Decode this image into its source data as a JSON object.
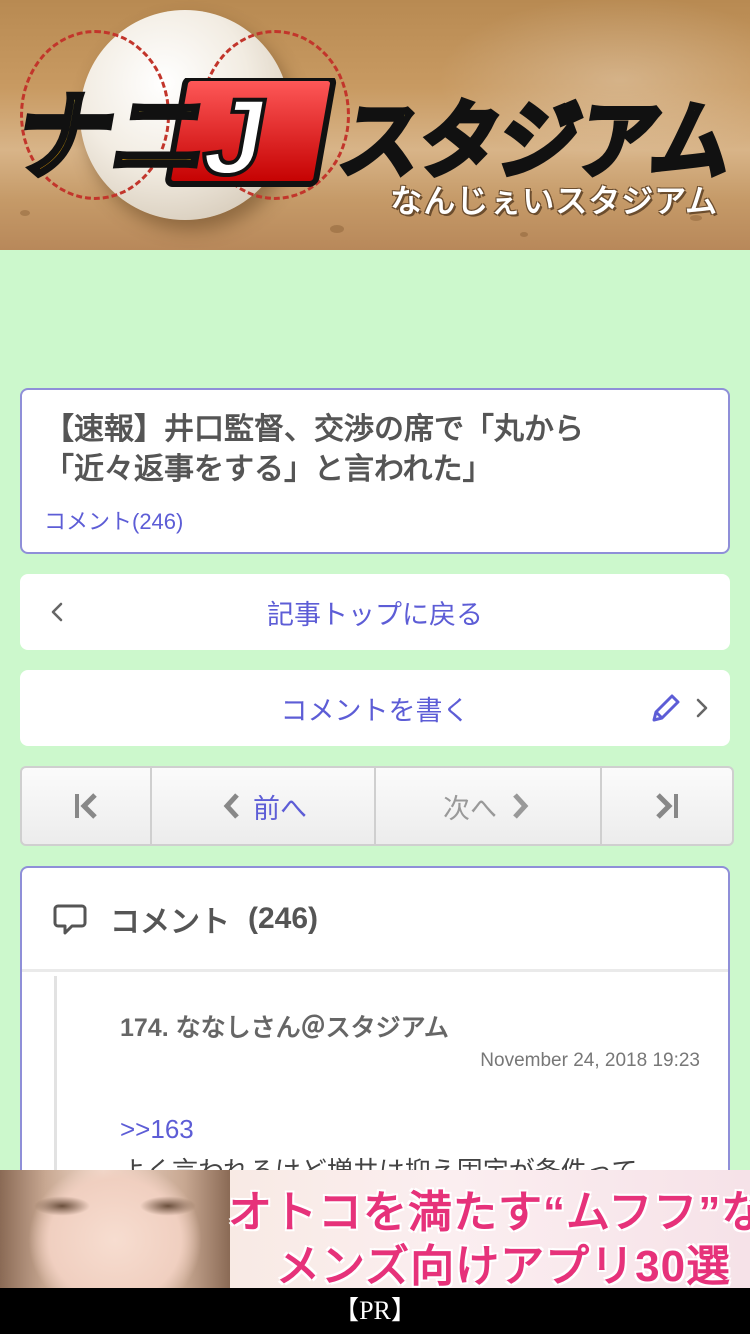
{
  "header": {
    "logo_text": "ナニJスタジアム",
    "logo_sub": "なんじぇいスタジアム"
  },
  "article": {
    "title": "【速報】井口監督、交渉の席で「丸から「近々返事をする」と言われた」",
    "comment_link": "コメント(246)"
  },
  "buttons": {
    "back_label": "記事トップに戻る",
    "write_label": "コメントを書く"
  },
  "pager": {
    "prev_label": "前へ",
    "next_label": "次へ"
  },
  "comments": {
    "header_label": "コメント",
    "count": "(246)",
    "items": [
      {
        "head": "174.  ななしさん＠スタジアム",
        "date": "November 24, 2018 19:23",
        "reply": ">>163",
        "body": "よく言われるけど増井は抑え固定が条件って"
      }
    ]
  },
  "ad": {
    "line1": "オトコを満たす“ムフフ”な",
    "line2": "メンズ向けアプリ30選",
    "pr_label": "【PR】"
  },
  "colors": {
    "page_bg": "#ccf8cc",
    "accent": "#5d5dd6",
    "card_border": "#8f8fd8"
  }
}
